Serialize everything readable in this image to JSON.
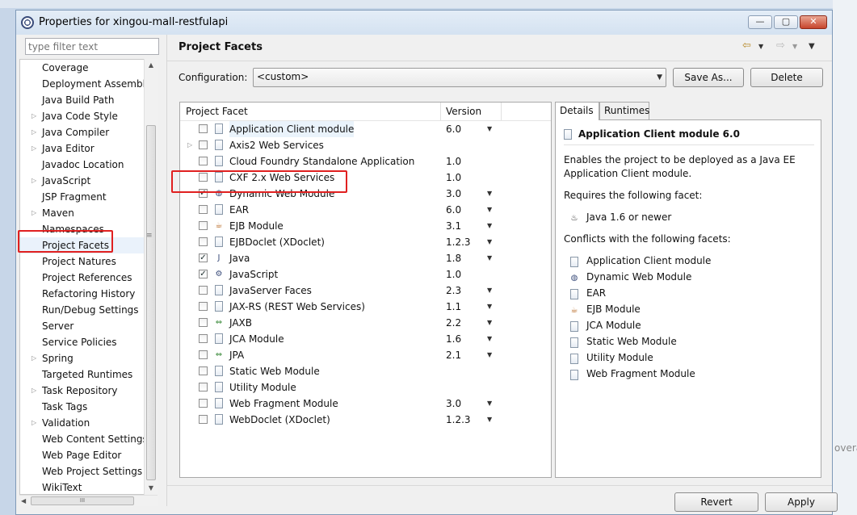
{
  "window": {
    "title": "Properties for xingou-mall-restfulapi"
  },
  "background": {
    "partial_text": "overa"
  },
  "filter": {
    "placeholder": "type filter text"
  },
  "tree": {
    "items": [
      {
        "label": "Coverage",
        "arrow": false
      },
      {
        "label": "Deployment Assembly",
        "arrow": false
      },
      {
        "label": "Java Build Path",
        "arrow": false
      },
      {
        "label": "Java Code Style",
        "arrow": true
      },
      {
        "label": "Java Compiler",
        "arrow": true
      },
      {
        "label": "Java Editor",
        "arrow": true
      },
      {
        "label": "Javadoc Location",
        "arrow": false
      },
      {
        "label": "JavaScript",
        "arrow": true
      },
      {
        "label": "JSP Fragment",
        "arrow": false
      },
      {
        "label": "Maven",
        "arrow": true
      },
      {
        "label": "Namespaces",
        "arrow": false
      },
      {
        "label": "Project Facets",
        "arrow": false,
        "selected": true
      },
      {
        "label": "Project Natures",
        "arrow": false
      },
      {
        "label": "Project References",
        "arrow": false
      },
      {
        "label": "Refactoring History",
        "arrow": false
      },
      {
        "label": "Run/Debug Settings",
        "arrow": false
      },
      {
        "label": "Server",
        "arrow": false
      },
      {
        "label": "Service Policies",
        "arrow": false
      },
      {
        "label": "Spring",
        "arrow": true
      },
      {
        "label": "Targeted Runtimes",
        "arrow": false
      },
      {
        "label": "Task Repository",
        "arrow": true
      },
      {
        "label": "Task Tags",
        "arrow": false
      },
      {
        "label": "Validation",
        "arrow": true
      },
      {
        "label": "Web Content Settings",
        "arrow": false
      },
      {
        "label": "Web Page Editor",
        "arrow": false
      },
      {
        "label": "Web Project Settings",
        "arrow": false
      },
      {
        "label": "WikiText",
        "arrow": false
      }
    ]
  },
  "page": {
    "title": "Project Facets",
    "configuration_label": "Configuration:",
    "configuration_value": "<custom>",
    "save_as": "Save As...",
    "delete": "Delete",
    "revert": "Revert",
    "apply": "Apply"
  },
  "facets": {
    "header_facet": "Project Facet",
    "header_version": "Version",
    "rows": [
      {
        "name": "Application Client module",
        "version": "6.0",
        "checked": false,
        "dropdown": true,
        "expand": false,
        "icon": "doc"
      },
      {
        "name": "Axis2 Web Services",
        "version": "",
        "checked": false,
        "dropdown": false,
        "expand": true,
        "icon": "doc"
      },
      {
        "name": "Cloud Foundry Standalone Application",
        "version": "1.0",
        "checked": false,
        "dropdown": false,
        "expand": false,
        "icon": "doc"
      },
      {
        "name": "CXF 2.x Web Services",
        "version": "1.0",
        "checked": false,
        "dropdown": false,
        "expand": false,
        "icon": "doc"
      },
      {
        "name": "Dynamic Web Module",
        "version": "3.0",
        "checked": true,
        "dropdown": true,
        "expand": false,
        "icon": "globe"
      },
      {
        "name": "EAR",
        "version": "6.0",
        "checked": false,
        "dropdown": true,
        "expand": false,
        "icon": "doc"
      },
      {
        "name": "EJB Module",
        "version": "3.1",
        "checked": false,
        "dropdown": true,
        "expand": false,
        "icon": "bean"
      },
      {
        "name": "EJBDoclet (XDoclet)",
        "version": "1.2.3",
        "checked": false,
        "dropdown": true,
        "expand": false,
        "icon": "doc"
      },
      {
        "name": "Java",
        "version": "1.8",
        "checked": true,
        "dropdown": true,
        "expand": false,
        "icon": "java"
      },
      {
        "name": "JavaScript",
        "version": "1.0",
        "checked": true,
        "dropdown": false,
        "expand": false,
        "icon": "js"
      },
      {
        "name": "JavaServer Faces",
        "version": "2.3",
        "checked": false,
        "dropdown": true,
        "expand": false,
        "icon": "doc"
      },
      {
        "name": "JAX-RS (REST Web Services)",
        "version": "1.1",
        "checked": false,
        "dropdown": true,
        "expand": false,
        "icon": "doc"
      },
      {
        "name": "JAXB",
        "version": "2.2",
        "checked": false,
        "dropdown": true,
        "expand": false,
        "icon": "arrows"
      },
      {
        "name": "JCA Module",
        "version": "1.6",
        "checked": false,
        "dropdown": true,
        "expand": false,
        "icon": "doc"
      },
      {
        "name": "JPA",
        "version": "2.1",
        "checked": false,
        "dropdown": true,
        "expand": false,
        "icon": "arrows"
      },
      {
        "name": "Static Web Module",
        "version": "",
        "checked": false,
        "dropdown": false,
        "expand": false,
        "icon": "doc"
      },
      {
        "name": "Utility Module",
        "version": "",
        "checked": false,
        "dropdown": false,
        "expand": false,
        "icon": "doc"
      },
      {
        "name": "Web Fragment Module",
        "version": "3.0",
        "checked": false,
        "dropdown": true,
        "expand": false,
        "icon": "doc"
      },
      {
        "name": "WebDoclet (XDoclet)",
        "version": "1.2.3",
        "checked": false,
        "dropdown": true,
        "expand": false,
        "icon": "doc"
      }
    ]
  },
  "details": {
    "tab_details": "Details",
    "tab_runtimes": "Runtimes",
    "title": "Application Client module 6.0",
    "description_1": "Enables the project to be deployed as a Java EE",
    "description_2": "Application Client module.",
    "requires_label": "Requires the following facet:",
    "requires_item": "Java 1.6 or newer",
    "conflicts_label": "Conflicts with the following facets:",
    "conflicts": [
      "Application Client module",
      "Dynamic Web Module",
      "EAR",
      "EJB Module",
      "JCA Module",
      "Static Web Module",
      "Utility Module",
      "Web Fragment Module"
    ]
  },
  "colors": {
    "annotation_red": "#e02020",
    "accent_blue": "#3a4c7a"
  }
}
